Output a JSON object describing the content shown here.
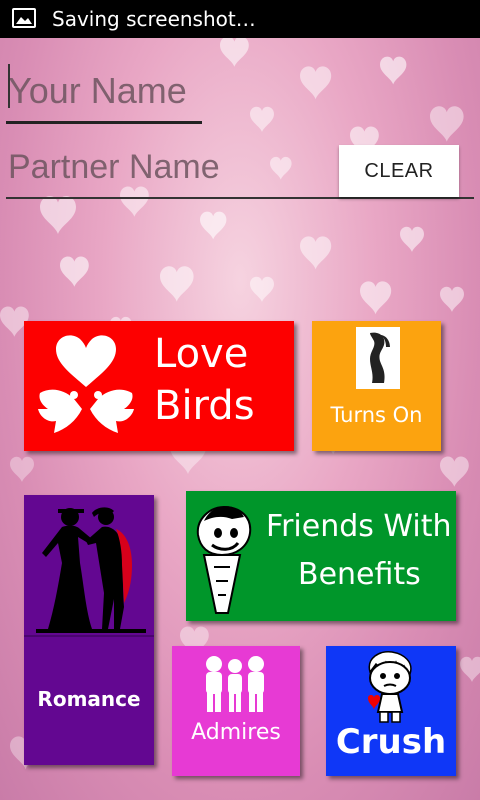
{
  "status_bar": {
    "text": "Saving screenshot…",
    "icon": "image-icon"
  },
  "form": {
    "your_name_placeholder": "Your Name",
    "partner_name_placeholder": "Partner Name",
    "clear_label": "CLEAR"
  },
  "tiles": {
    "love_birds": {
      "line1": "Love",
      "line2": "Birds",
      "color": "#fd0000"
    },
    "turns_on": {
      "label": "Turns On",
      "color": "#fca30f"
    },
    "friends_with_benefits": {
      "line1": "Friends With",
      "line2": "Benefits",
      "color": "#00962a"
    },
    "romance": {
      "label": "Romance",
      "color": "#630791"
    },
    "admires": {
      "label": "Admires",
      "color": "#e73ad4"
    },
    "crush": {
      "label": "Crush",
      "color": "#0f37f7"
    }
  }
}
